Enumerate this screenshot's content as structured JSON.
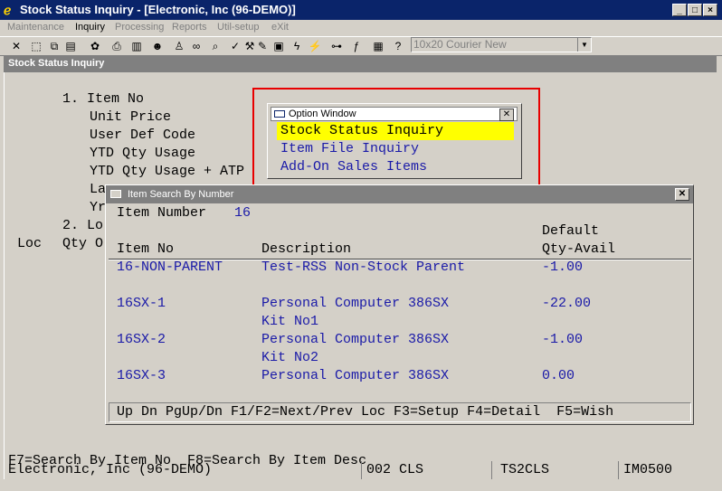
{
  "window": {
    "title": "Stock Status Inquiry - [Electronic, Inc (96-DEMO)]",
    "min": "_",
    "max": "□",
    "close": "×"
  },
  "menu": [
    "Maintenance",
    "Inquiry",
    "Processing",
    "Reports",
    "Util-setup",
    "eXit"
  ],
  "toolbar": {
    "font_select": "10x20 Courier New"
  },
  "inner_title": "Stock Status Inquiry",
  "screen": {
    "field1_label": "1. Item No",
    "unit_price": "Unit Price",
    "user_def_code": "User Def Code",
    "ytd_qty_usage": "YTD Qty Usage",
    "ytd_qty_usage_atp": "YTD Qty Usage + ATP",
    "partial_la": "La",
    "partial_yr": "Yr",
    "field2_label": "2. Lo",
    "col_loc": "Loc",
    "col_qty": "Qty O",
    "function_keys": "F7=Search By Item No  F8=Search By Item Desc",
    "status_company": "Electronic, Inc (96-DEMO)",
    "status_cls": "002 CLS",
    "status_prog": "TS2CLS",
    "status_code": "IM0500"
  },
  "option_window": {
    "title": "Option Window",
    "items": [
      "Stock Status Inquiry",
      "Item File Inquiry",
      "Add-On Sales Items"
    ],
    "selected_index": 0
  },
  "search_window": {
    "title": "Item Search By Number",
    "item_number_label": "Item Number",
    "item_number_value": "16",
    "headers": {
      "item_no": "Item No",
      "description": "Description",
      "qty_line1": "Default",
      "qty_line2": "Qty-Avail"
    },
    "rows": [
      {
        "item_no": "16-NON-PARENT",
        "description": "Test-RSS Non-Stock Parent",
        "desc2": "",
        "qty": "-1.00"
      },
      {
        "item_no": "16SX-1",
        "description": "Personal Computer 386SX",
        "desc2": "Kit No1",
        "qty": "-22.00"
      },
      {
        "item_no": "16SX-2",
        "description": "Personal Computer 386SX",
        "desc2": "Kit No2",
        "qty": "-1.00"
      },
      {
        "item_no": "16SX-3",
        "description": "Personal Computer 386SX",
        "desc2": "",
        "qty": "0.00"
      }
    ],
    "footer": "Up Dn PgUp/Dn F1/F2=Next/Prev Loc F3=Setup F4=Detail  F5=Wish"
  },
  "colors": {
    "titlebar": "#0a246a",
    "data_text": "#1a1aa8",
    "highlight": "#ffff00",
    "annotation": "#e80000"
  }
}
